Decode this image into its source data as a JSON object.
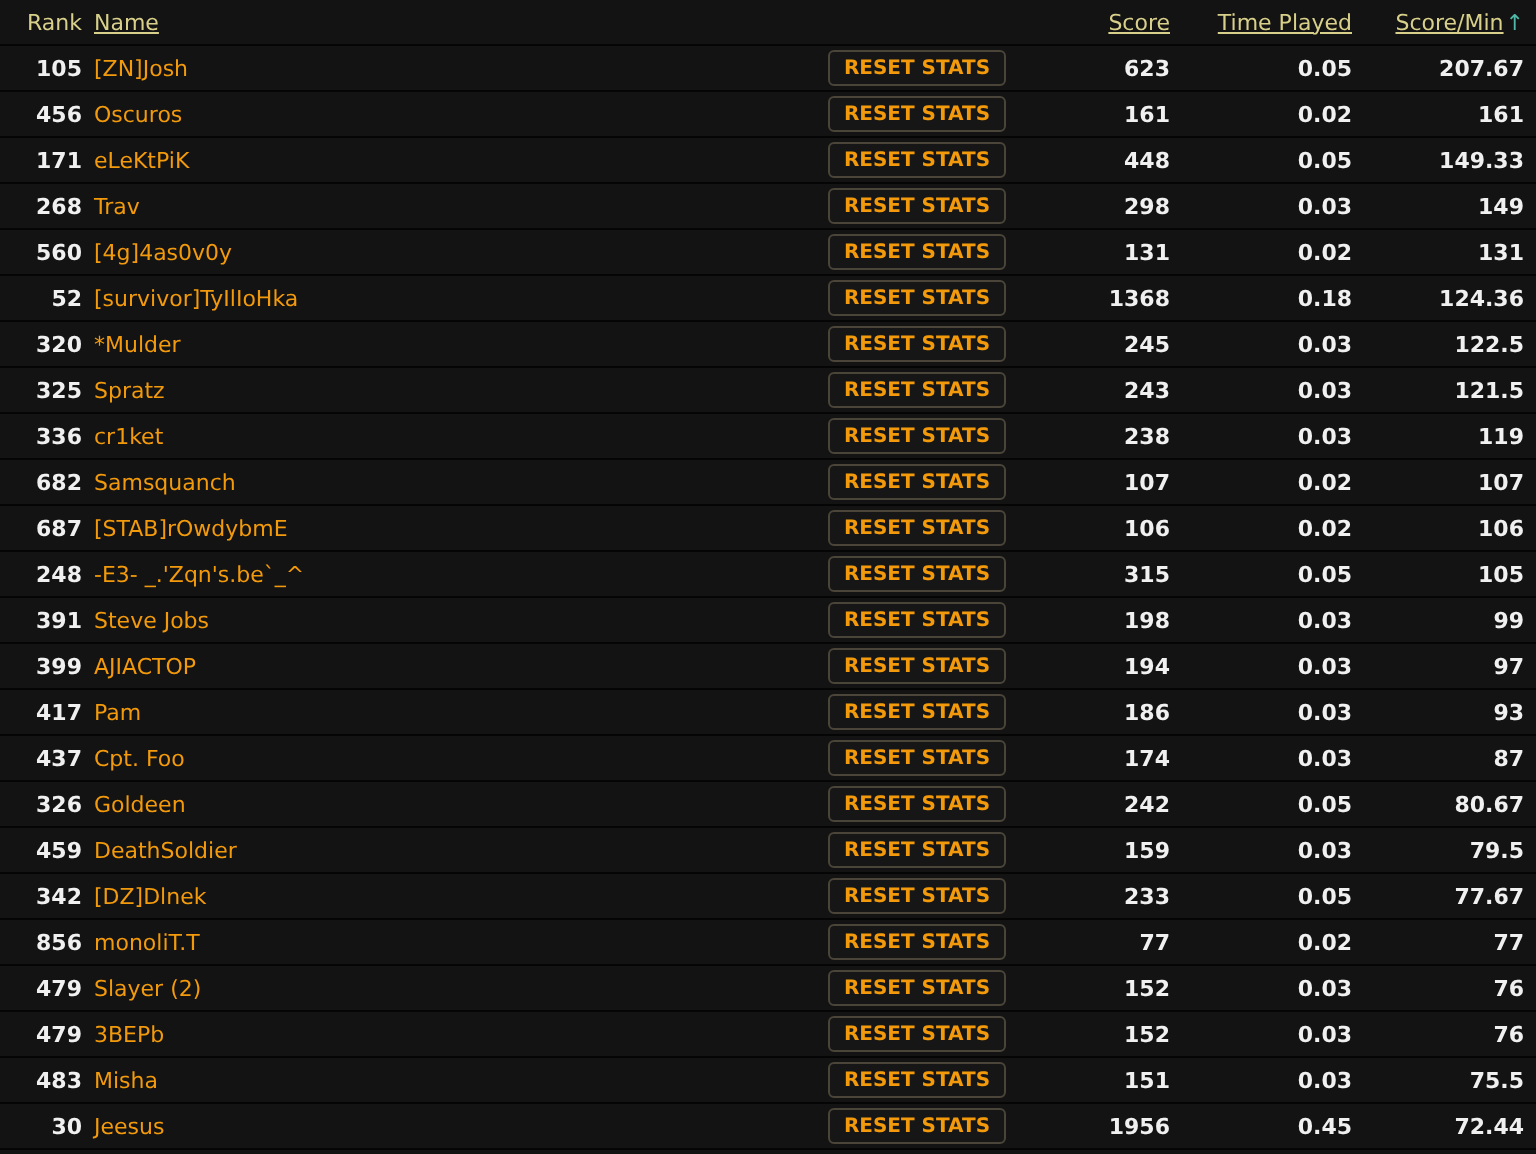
{
  "columns": [
    {
      "label": "Rank",
      "link": false
    },
    {
      "label": "Name",
      "link": true
    },
    {
      "label": "Score",
      "link": true
    },
    {
      "label": "Time Played",
      "link": true
    },
    {
      "label": "Score/Min",
      "link": true,
      "sort_indicator": "↑"
    }
  ],
  "rows": [
    {
      "rank": "105",
      "name": "[ZN]Josh",
      "action": "RESET STATS",
      "score": "623",
      "time": "0.05",
      "score_per_min": "207.67"
    },
    {
      "rank": "456",
      "name": "Oscuros",
      "action": "RESET STATS",
      "score": "161",
      "time": "0.02",
      "score_per_min": "161"
    },
    {
      "rank": "171",
      "name": "eLeKtPiK",
      "action": "RESET STATS",
      "score": "448",
      "time": "0.05",
      "score_per_min": "149.33"
    },
    {
      "rank": "268",
      "name": "Trav",
      "action": "RESET STATS",
      "score": "298",
      "time": "0.03",
      "score_per_min": "149"
    },
    {
      "rank": "560",
      "name": "[4g]4as0v0y",
      "action": "RESET STATS",
      "score": "131",
      "time": "0.02",
      "score_per_min": "131"
    },
    {
      "rank": "52",
      "name": "[survivor]TyIlIoHka",
      "action": "RESET STATS",
      "score": "1368",
      "time": "0.18",
      "score_per_min": "124.36"
    },
    {
      "rank": "320",
      "name": "*Mulder",
      "action": "RESET STATS",
      "score": "245",
      "time": "0.03",
      "score_per_min": "122.5"
    },
    {
      "rank": "325",
      "name": "Spratz",
      "action": "RESET STATS",
      "score": "243",
      "time": "0.03",
      "score_per_min": "121.5"
    },
    {
      "rank": "336",
      "name": "cr1ket",
      "action": "RESET STATS",
      "score": "238",
      "time": "0.03",
      "score_per_min": "119"
    },
    {
      "rank": "682",
      "name": "Samsquanch",
      "action": "RESET STATS",
      "score": "107",
      "time": "0.02",
      "score_per_min": "107"
    },
    {
      "rank": "687",
      "name": "[STAB]rOwdybmE",
      "action": "RESET STATS",
      "score": "106",
      "time": "0.02",
      "score_per_min": "106"
    },
    {
      "rank": "248",
      "name": "-E3- _.'Zqn's.be`_^",
      "action": "RESET STATS",
      "score": "315",
      "time": "0.05",
      "score_per_min": "105"
    },
    {
      "rank": "391",
      "name": "Steve Jobs",
      "action": "RESET STATS",
      "score": "198",
      "time": "0.03",
      "score_per_min": "99"
    },
    {
      "rank": "399",
      "name": "AJIACTOP",
      "action": "RESET STATS",
      "score": "194",
      "time": "0.03",
      "score_per_min": "97"
    },
    {
      "rank": "417",
      "name": "Pam",
      "action": "RESET STATS",
      "score": "186",
      "time": "0.03",
      "score_per_min": "93"
    },
    {
      "rank": "437",
      "name": "Cpt. Foo",
      "action": "RESET STATS",
      "score": "174",
      "time": "0.03",
      "score_per_min": "87"
    },
    {
      "rank": "326",
      "name": "Goldeen",
      "action": "RESET STATS",
      "score": "242",
      "time": "0.05",
      "score_per_min": "80.67"
    },
    {
      "rank": "459",
      "name": "DeathSoldier",
      "action": "RESET STATS",
      "score": "159",
      "time": "0.03",
      "score_per_min": "79.5"
    },
    {
      "rank": "342",
      "name": "[DZ]Dlnek",
      "action": "RESET STATS",
      "score": "233",
      "time": "0.05",
      "score_per_min": "77.67"
    },
    {
      "rank": "856",
      "name": "monoliT.T",
      "action": "RESET STATS",
      "score": "77",
      "time": "0.02",
      "score_per_min": "77"
    },
    {
      "rank": "479",
      "name": "Slayer (2)",
      "action": "RESET STATS",
      "score": "152",
      "time": "0.03",
      "score_per_min": "76"
    },
    {
      "rank": "479",
      "name": "3BEPb",
      "action": "RESET STATS",
      "score": "152",
      "time": "0.03",
      "score_per_min": "76"
    },
    {
      "rank": "483",
      "name": "Misha",
      "action": "RESET STATS",
      "score": "151",
      "time": "0.03",
      "score_per_min": "75.5"
    },
    {
      "rank": "30",
      "name": "Jeesus",
      "action": "RESET STATS",
      "score": "1956",
      "time": "0.45",
      "score_per_min": "72.44"
    }
  ]
}
